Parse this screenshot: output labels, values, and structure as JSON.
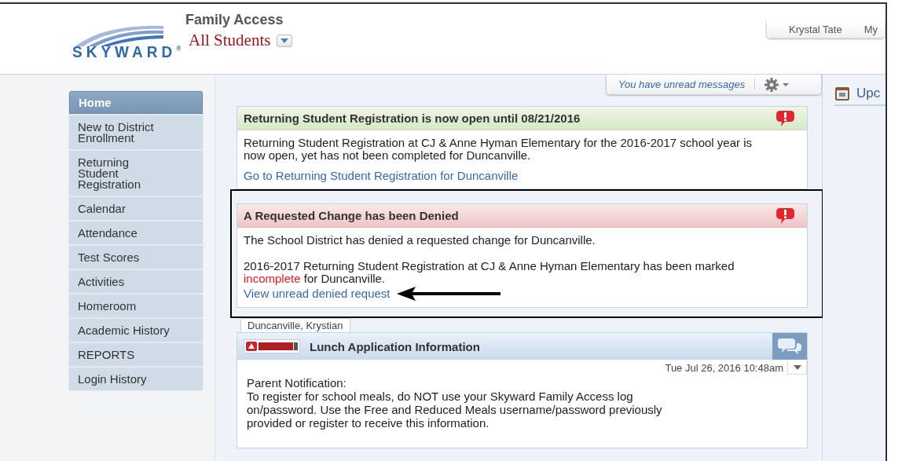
{
  "header": {
    "logo_text": "SKYWARD$^{®}$",
    "app_title": "Family Access",
    "student_selector": "All Students",
    "user_menu": [
      "Krystal Tate",
      "My"
    ]
  },
  "sidebar": {
    "items": [
      {
        "label": "Home",
        "selected": true
      },
      {
        "label": "New to District\nEnrollment",
        "selected": false
      },
      {
        "label": "Returning\nStudent\nRegistration",
        "selected": false
      },
      {
        "label": "Calendar",
        "selected": false
      },
      {
        "label": "Attendance",
        "selected": false
      },
      {
        "label": "Test Scores",
        "selected": false
      },
      {
        "label": "Activities",
        "selected": false
      },
      {
        "label": "Homeroom",
        "selected": false
      },
      {
        "label": "Academic History",
        "selected": false
      },
      {
        "label": "REPORTS",
        "selected": false
      },
      {
        "label": "Login History",
        "selected": false
      }
    ]
  },
  "messages_bar": {
    "text": "You have unread messages"
  },
  "alerts": [
    {
      "kind": "notice",
      "title": "Returning Student Registration is now open until 08/21/2016",
      "highlighted": false,
      "body": [
        {
          "kind": "text",
          "segments": [
            {
              "kind": "plain",
              "text": "Returning Student Registration at CJ & Anne Hyman Elementary for the 2016-2017 school year is now open, yet has not been completed for Duncanville."
            }
          ]
        },
        {
          "kind": "link",
          "text": "Go to Returning Student Registration for Duncanville",
          "spaced": true,
          "pointer": false
        }
      ]
    },
    {
      "kind": "denied",
      "title": "A Requested Change has been Denied",
      "highlighted": true,
      "body": [
        {
          "kind": "text",
          "segments": [
            {
              "kind": "plain",
              "text": "The School District has denied a requested change for Duncanville."
            }
          ]
        },
        {
          "kind": "text",
          "segments": [
            {
              "kind": "plain",
              "text": "2016-2017 Returning Student Registration at CJ & Anne Hyman Elementary has been marked "
            },
            {
              "kind": "highlight",
              "text": "incomplete"
            },
            {
              "kind": "plain",
              "text": " for Duncanville."
            }
          ]
        },
        {
          "kind": "link",
          "text": "View unread denied request",
          "spaced": false,
          "pointer": true
        }
      ]
    }
  ],
  "message": {
    "tab": "Duncanville, Krystian",
    "title": "Lunch Application Information",
    "timestamp": "Tue Jul 26, 2016 10:48am",
    "heading": "Parent Notification:",
    "text": "To register for school meals, do NOT use your Skyward Family Access log on/password. Use the Free and Reduced Meals username/password previously provided or register to receive this information."
  },
  "right_panel": {
    "title": "Upc"
  }
}
